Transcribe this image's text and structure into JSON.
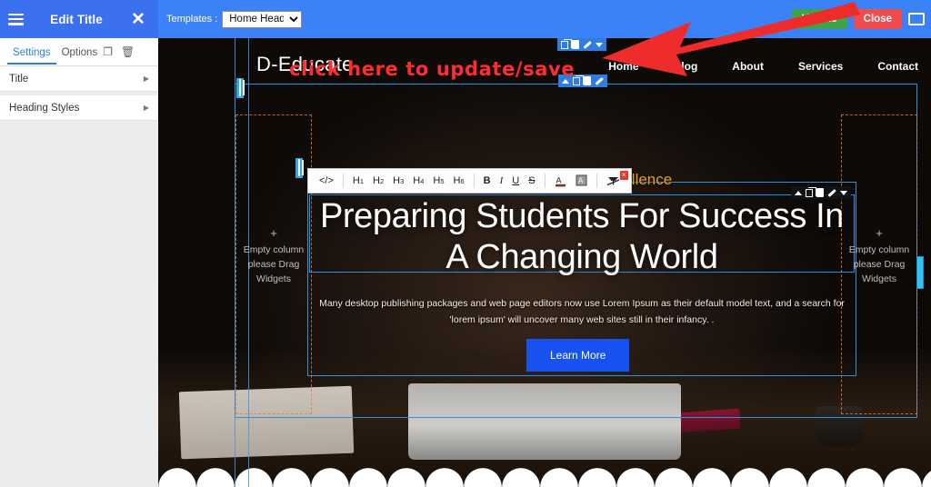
{
  "sidebar": {
    "title": "Edit Title",
    "menu_icon": "hamburger-icon",
    "close_icon": "close-icon",
    "tabs": [
      {
        "label": "Settings",
        "active": true
      },
      {
        "label": "Options",
        "active": false
      }
    ],
    "tab_icons": [
      {
        "name": "duplicate-icon",
        "glyph": "❐"
      },
      {
        "name": "trash-icon",
        "glyph": "🗑"
      }
    ],
    "rows": [
      {
        "label": "Title",
        "arrow": "▶"
      },
      {
        "label": "Heading Styles",
        "arrow": "▶"
      }
    ],
    "grip": "▸"
  },
  "topbar": {
    "templates_label": "Templates :",
    "template_selected": "Home Header",
    "template_options": [
      "Home Header"
    ],
    "update_label": "Update",
    "close_label": "Close",
    "monitor_icon": "monitor-icon",
    "update_color": "#3fa34a",
    "close_color": "#ef4d4d",
    "bar_color": "#3b82f8"
  },
  "annotation": {
    "text": "click here to update/save",
    "color": "#ff2d2d",
    "arrow_icon": "red-arrow-icon"
  },
  "site": {
    "logo": "D-Educate",
    "nav": [
      "Home",
      "Blog",
      "About",
      "Services",
      "Contact"
    ]
  },
  "hero": {
    "eyebrow": "Excellence",
    "headline": "Preparing Students For Success In A Changing World",
    "subtext": "Many desktop publishing packages and web page editors now use Lorem Ipsum as their default model text, and a search for 'lorem ipsum' will uncover many web sites still in their infancy. .",
    "cta_label": "Learn More",
    "cta_color": "#1752f0",
    "eyebrow_color": "#e8a317"
  },
  "empty_columns": {
    "plus": "+",
    "text": "Empty column please Drag Widgets"
  },
  "rte": {
    "code_label": "</>",
    "headings": [
      "H1",
      "H2",
      "H3",
      "H4",
      "H5",
      "H6"
    ],
    "bold": "B",
    "italic": "I",
    "underline": "U",
    "strike": "S",
    "text_color_icon": "text-color-icon",
    "highlight_icon": "highlight-color-icon",
    "clear_format_icon": "clear-formatting-icon",
    "close_glyph": "×",
    "badge_icon": "columns-icon"
  },
  "widget_toolbars": {
    "logo_badge_icon": "columns-icon",
    "actions": {
      "move_up": "move-up-icon",
      "duplicate": "duplicate-icon",
      "delete": "delete-icon",
      "edit": "edit-icon",
      "more": "more-dropdown-icon"
    }
  }
}
